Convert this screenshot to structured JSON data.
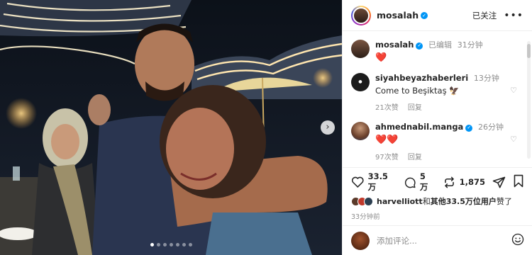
{
  "post": {
    "username": "mosalah",
    "follow_label": "已关注",
    "more_label": "•••",
    "caption": {
      "username": "mosalah",
      "edited_label": "已编辑",
      "time": "31分钟",
      "text": "❤️"
    }
  },
  "photo": {
    "next_label": "›",
    "dot_count": 7,
    "active_dot": 0
  },
  "comments": [
    {
      "username": "siyahbeyazhaberleri",
      "time": "13分钟",
      "text": "Come to Beşiktaş 🦅",
      "verified": false,
      "likes": "21次赞",
      "reply": "回复"
    },
    {
      "username": "ahmednabil.manga",
      "time": "26分钟",
      "text": "❤️❤️",
      "verified": true,
      "likes": "97次赞",
      "reply": "回复"
    }
  ],
  "actions": {
    "likes_count": "33.5 万",
    "comments_count": "5 万",
    "reposts_count": "1,875"
  },
  "likes_summary": {
    "text_prefix": "harvelliott",
    "text_middle": "和",
    "text_bold": "其他33.5万位用户",
    "text_suffix": "赞了"
  },
  "time_ago": "33分钟前",
  "add_comment": {
    "placeholder": "添加评论..."
  },
  "colors": {
    "verified": "#0095f6",
    "heart": "#ed1c24"
  }
}
